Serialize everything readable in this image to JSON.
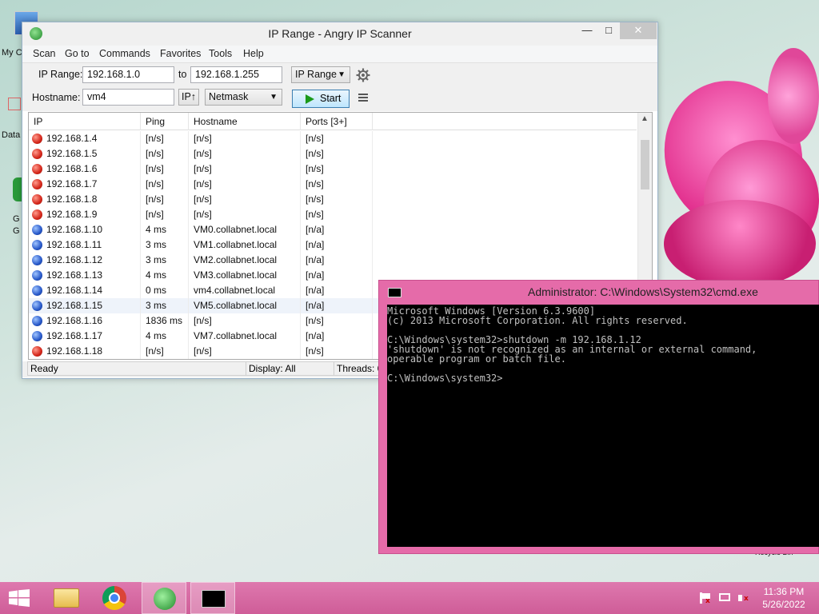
{
  "desktop": {
    "icon_labels": [
      "My C",
      "Data",
      "G",
      "G"
    ],
    "right_label": "Recycle Bin"
  },
  "ipscanner": {
    "title": "IP Range - Angry IP Scanner",
    "menu": [
      "Scan",
      "Go to",
      "Commands",
      "Favorites",
      "Tools",
      "Help"
    ],
    "ip_range_label": "IP Range:",
    "ip_from": "192.168.1.0",
    "to_label": "to",
    "ip_to": "192.168.1.255",
    "feeder_select": "IP Range",
    "hostname_label": "Hostname:",
    "hostname_value": "vm4",
    "ip_up_button": "IP↑",
    "netmask_select": "Netmask",
    "start_label": "Start",
    "columns": [
      "IP",
      "Ping",
      "Hostname",
      "Ports [3+]"
    ],
    "rows": [
      {
        "ip": "192.168.1.4",
        "ping": "[n/s]",
        "host": "[n/s]",
        "ports": "[n/s]",
        "status": "dead"
      },
      {
        "ip": "192.168.1.5",
        "ping": "[n/s]",
        "host": "[n/s]",
        "ports": "[n/s]",
        "status": "dead"
      },
      {
        "ip": "192.168.1.6",
        "ping": "[n/s]",
        "host": "[n/s]",
        "ports": "[n/s]",
        "status": "dead"
      },
      {
        "ip": "192.168.1.7",
        "ping": "[n/s]",
        "host": "[n/s]",
        "ports": "[n/s]",
        "status": "dead"
      },
      {
        "ip": "192.168.1.8",
        "ping": "[n/s]",
        "host": "[n/s]",
        "ports": "[n/s]",
        "status": "dead"
      },
      {
        "ip": "192.168.1.9",
        "ping": "[n/s]",
        "host": "[n/s]",
        "ports": "[n/s]",
        "status": "dead"
      },
      {
        "ip": "192.168.1.10",
        "ping": "4 ms",
        "host": "VM0.collabnet.local",
        "ports": "[n/a]",
        "status": "alive"
      },
      {
        "ip": "192.168.1.11",
        "ping": "3 ms",
        "host": "VM1.collabnet.local",
        "ports": "[n/a]",
        "status": "alive"
      },
      {
        "ip": "192.168.1.12",
        "ping": "3 ms",
        "host": "VM2.collabnet.local",
        "ports": "[n/a]",
        "status": "alive"
      },
      {
        "ip": "192.168.1.13",
        "ping": "4 ms",
        "host": "VM3.collabnet.local",
        "ports": "[n/a]",
        "status": "alive"
      },
      {
        "ip": "192.168.1.14",
        "ping": "0 ms",
        "host": "vm4.collabnet.local",
        "ports": "[n/a]",
        "status": "alive"
      },
      {
        "ip": "192.168.1.15",
        "ping": "3 ms",
        "host": "VM5.collabnet.local",
        "ports": "[n/a]",
        "status": "alive"
      },
      {
        "ip": "192.168.1.16",
        "ping": "1836 ms",
        "host": "[n/s]",
        "ports": "[n/s]",
        "status": "alive"
      },
      {
        "ip": "192.168.1.17",
        "ping": "4 ms",
        "host": "VM7.collabnet.local",
        "ports": "[n/a]",
        "status": "alive"
      },
      {
        "ip": "192.168.1.18",
        "ping": "[n/s]",
        "host": "[n/s]",
        "ports": "[n/s]",
        "status": "dead"
      }
    ],
    "status_ready": "Ready",
    "status_display": "Display: All",
    "status_threads": "Threads: 0"
  },
  "cmd": {
    "title": "Administrator: C:\\Windows\\System32\\cmd.exe",
    "lines": [
      "Microsoft Windows [Version 6.3.9600]",
      "(c) 2013 Microsoft Corporation. All rights reserved.",
      "",
      "C:\\Windows\\system32>shutdown -m 192.168.1.12",
      "'shutdown' is not recognized as an internal or external command,",
      "operable program or batch file.",
      "",
      "C:\\Windows\\system32>"
    ]
  },
  "taskbar": {
    "time": "11:36 PM",
    "date": "5/26/2022"
  },
  "colors": {
    "taskbar": "#d866a2",
    "cmd_frame": "#e56ba9",
    "alive": "#2758c9",
    "dead": "#d4261a"
  }
}
